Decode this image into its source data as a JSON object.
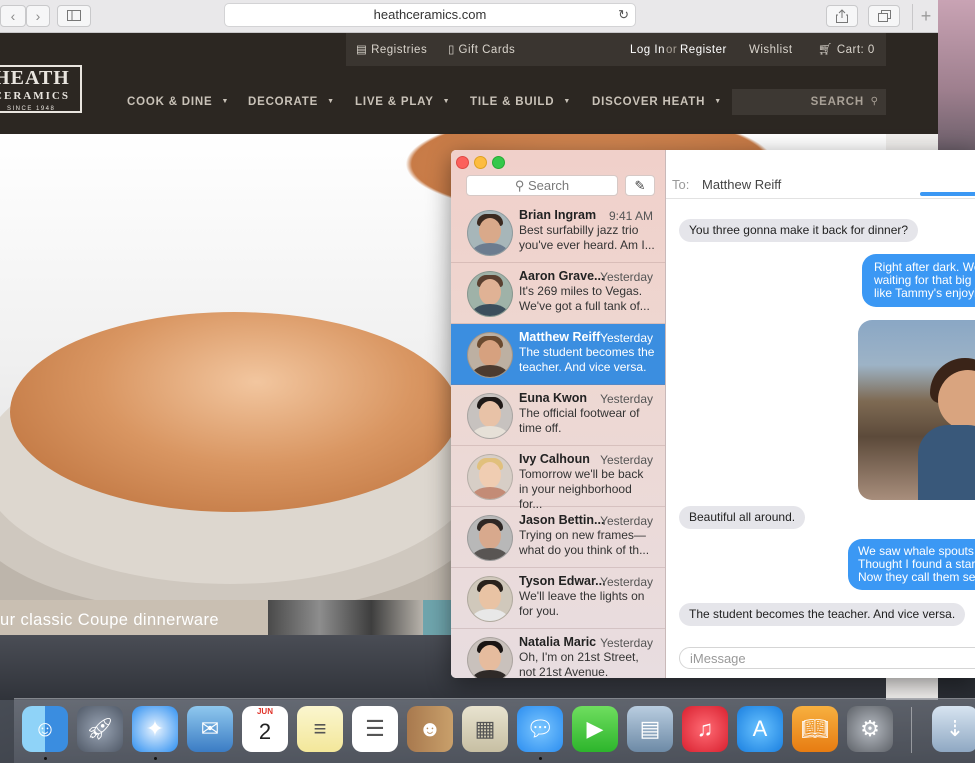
{
  "browser": {
    "url": "heathceramics.com",
    "back_icon": "chevron-left-icon",
    "forward_icon": "chevron-right-icon",
    "new_tab_label": "+"
  },
  "site": {
    "utility": {
      "registries": "Registries",
      "gift_cards": "Gift Cards",
      "login": "Log In",
      "or": "or",
      "register": "Register",
      "wishlist": "Wishlist",
      "cart": "Cart: 0"
    },
    "logo": {
      "line1": "HEATH",
      "line2": "CERAMICS",
      "since": "SINCE 1948"
    },
    "nav": [
      "COOK & DINE",
      "DECORATE",
      "LIVE & PLAY",
      "TILE & BUILD",
      "DISCOVER HEATH"
    ],
    "search_label": "SEARCH",
    "hero_caption": "ur classic Coupe dinnerware"
  },
  "messages": {
    "search_placeholder": "Search",
    "conversations": [
      {
        "name": "Brian Ingram",
        "time": "9:41 AM",
        "preview": "Best surfabilly jazz trio you've ever heard. Am I...",
        "selected": false
      },
      {
        "name": "Aaron Grave...",
        "time": "Yesterday",
        "preview": "It's 269 miles to Vegas. We've got a full tank of...",
        "selected": false
      },
      {
        "name": "Matthew Reiff",
        "time": "Yesterday",
        "preview": "The student becomes the teacher. And vice versa.",
        "selected": true
      },
      {
        "name": "Euna Kwon",
        "time": "Yesterday",
        "preview": "The official footwear of time off.",
        "selected": false
      },
      {
        "name": "Ivy Calhoun",
        "time": "Yesterday",
        "preview": "Tomorrow we'll be back in your neighborhood for...",
        "selected": false
      },
      {
        "name": "Jason Bettin...",
        "time": "Yesterday",
        "preview": "Trying on new frames— what do you think of th...",
        "selected": false
      },
      {
        "name": "Tyson Edwar...",
        "time": "Yesterday",
        "preview": "We'll leave the lights on for you.",
        "selected": false
      },
      {
        "name": "Natalia Maric",
        "time": "Yesterday",
        "preview": "Oh, I'm on 21st Street, not 21st Avenue.",
        "selected": false
      }
    ],
    "chat": {
      "to_label": "To:",
      "to_name": "Matthew Reiff",
      "bubbles": [
        {
          "dir": "in",
          "text": "You three gonna make it back for dinner?"
        },
        {
          "dir": "out",
          "text": "Right after dark. We're\nwaiting for that big sunset\nlike Tammy's enjoying"
        },
        {
          "dir": "in",
          "text": "Beautiful all around."
        },
        {
          "dir": "out",
          "text": "We saw whale spouts a\nThought I found a starfi\nNow they call them sea"
        },
        {
          "dir": "in",
          "text": "The student becomes the teacher. And vice versa."
        }
      ],
      "input_placeholder": "iMessage"
    }
  },
  "dock": {
    "apps": [
      {
        "name": "Finder",
        "icon": "finder-icon",
        "running": true
      },
      {
        "name": "Launchpad",
        "icon": "launchpad-icon",
        "running": false
      },
      {
        "name": "Safari",
        "icon": "safari-icon",
        "running": true
      },
      {
        "name": "Mail",
        "icon": "mail-icon",
        "running": false
      },
      {
        "name": "Calendar",
        "icon": "calendar-icon",
        "running": false,
        "month": "JUN",
        "day": "2"
      },
      {
        "name": "Notes",
        "icon": "notes-icon",
        "running": false
      },
      {
        "name": "Reminders",
        "icon": "reminders-icon",
        "running": false
      },
      {
        "name": "Contacts",
        "icon": "contacts-icon",
        "running": false
      },
      {
        "name": "Preview",
        "icon": "preview-icon",
        "running": false
      },
      {
        "name": "Messages",
        "icon": "messages-icon",
        "running": true
      },
      {
        "name": "FaceTime",
        "icon": "facetime-icon",
        "running": false
      },
      {
        "name": "iPhoto",
        "icon": "photos-icon",
        "running": false
      },
      {
        "name": "iTunes",
        "icon": "music-icon",
        "running": false
      },
      {
        "name": "App Store",
        "icon": "app-store-icon",
        "running": false
      },
      {
        "name": "iBooks",
        "icon": "books-icon",
        "running": false
      },
      {
        "name": "System Preferences",
        "icon": "system-preferences-icon",
        "running": false
      },
      {
        "name": "Downloads",
        "icon": "downloads-icon",
        "running": false
      }
    ]
  },
  "colors": {
    "message_blue": "#3b98f4",
    "selection_blue": "#3b8ee0",
    "site_header": "#2c2722"
  }
}
